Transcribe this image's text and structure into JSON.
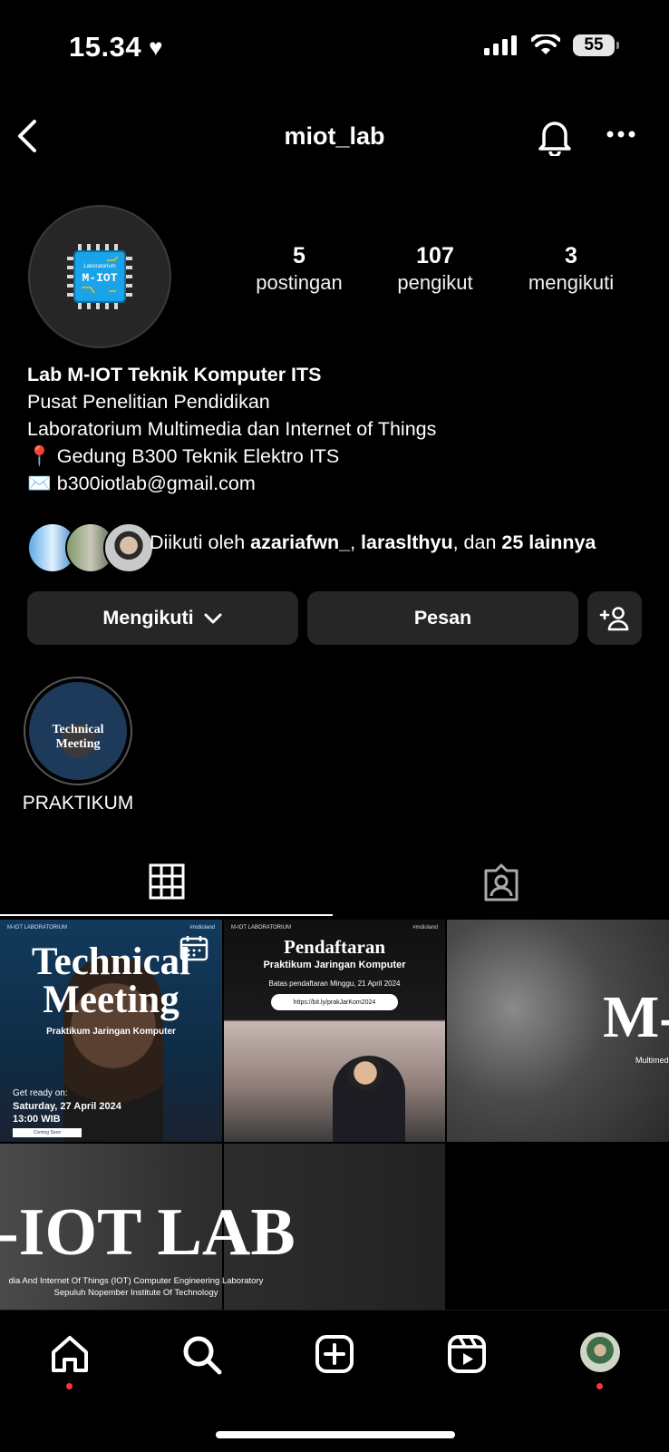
{
  "status_bar": {
    "time": "15.34",
    "battery": "55"
  },
  "header": {
    "username": "miot_lab"
  },
  "profile": {
    "avatar_text_top": "Laboratorium",
    "avatar_text_main": "M-IOT",
    "stats": [
      {
        "value": "5",
        "label": "postingan"
      },
      {
        "value": "107",
        "label": "pengikut"
      },
      {
        "value": "3",
        "label": "mengikuti"
      }
    ],
    "name": "Lab M-IOT Teknik Komputer ITS",
    "category": "Pusat Penelitian Pendidikan",
    "bio_line": "Laboratorium Multimedia dan Internet of Things",
    "location": "📍 Gedung B300 Teknik Elektro ITS",
    "email": "✉️ b300iotlab@gmail.com"
  },
  "followed_by": {
    "prefix": "Diikuti oleh ",
    "user1": "azariafwn_",
    "sep": ", ",
    "user2": "laraslthyu",
    "mid": ", dan ",
    "others": "25 lainnya"
  },
  "actions": {
    "following_label": "Mengikuti",
    "message_label": "Pesan"
  },
  "highlights": [
    {
      "label": "PRAKTIKUM",
      "cover_line1": "Technical",
      "cover_line2": "Meeting"
    }
  ],
  "posts": {
    "tile1": {
      "lab": "M-IOT LABORATORIUM",
      "tag": "#mdioland",
      "title1": "Technical",
      "title2": "Meeting",
      "subtitle": "Praktikum Jaringan Komputer",
      "ready": "Get ready on:",
      "date": "Saturday, 27 April 2024",
      "time": "13:00 WIB",
      "badge": "Coming Soon"
    },
    "tile2": {
      "lab": "M-IOT LABORATORIUM",
      "tag": "#mdioland",
      "title": "Pendaftaran",
      "subtitle": "Praktikum Jaringan Komputer",
      "deadline": "Batas pendaftaran Minggu, 21 April 2024",
      "link": "https://bit.ly/prakJarKom2024"
    },
    "tile3": {
      "text": "M-",
      "caption": "Multimed"
    },
    "tile45": {
      "title": "-IOT LAB",
      "caption1": "dia And Internet Of Things (IOT) Computer Engineering Laboratory",
      "caption2": "Sepuluh Nopember Institute Of Technology"
    }
  },
  "colors": {
    "accent_red": "#ff3040",
    "button_bg": "#262626",
    "chip_blue": "#1aa3e8"
  }
}
